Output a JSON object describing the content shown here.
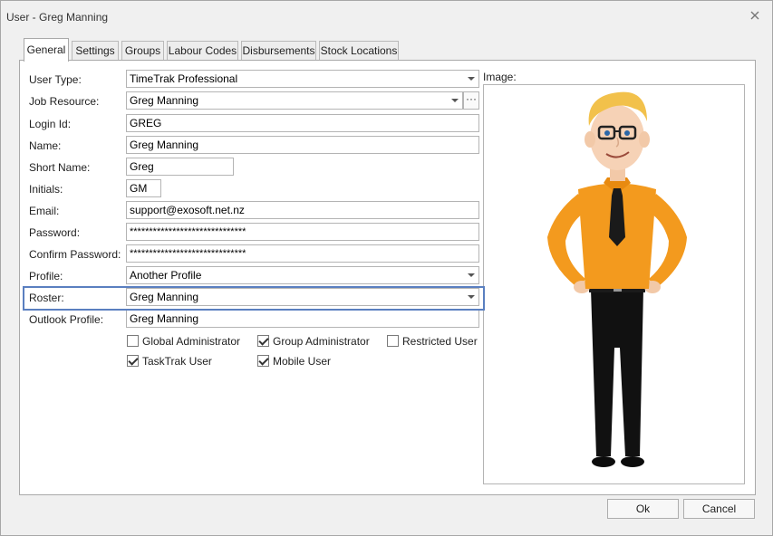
{
  "window": {
    "title": "User - Greg Manning"
  },
  "tabs": [
    {
      "label": "General"
    },
    {
      "label": "Settings"
    },
    {
      "label": "Groups"
    },
    {
      "label": "Labour Codes"
    },
    {
      "label": "Disbursements"
    },
    {
      "label": "Stock Locations"
    }
  ],
  "form": {
    "user_type": {
      "label": "User Type:",
      "value": "TimeTrak Professional"
    },
    "job_resource": {
      "label": "Job Resource:",
      "value": "Greg Manning"
    },
    "login_id": {
      "label": "Login Id:",
      "value": "GREG"
    },
    "name": {
      "label": "Name:",
      "value": "Greg Manning"
    },
    "short_name": {
      "label": "Short Name:",
      "value": "Greg"
    },
    "initials": {
      "label": "Initials:",
      "value": "GM"
    },
    "email": {
      "label": "Email:",
      "value": "support@exosoft.net.nz"
    },
    "password": {
      "label": "Password:",
      "value": "******************************"
    },
    "confirm_password": {
      "label": "Confirm Password:",
      "value": "******************************"
    },
    "profile": {
      "label": "Profile:",
      "value": "Another Profile"
    },
    "roster": {
      "label": "Roster:",
      "value": "Greg Manning"
    },
    "outlook_profile": {
      "label": "Outlook Profile:",
      "value": "Greg Manning"
    }
  },
  "checkboxes": {
    "global_admin": {
      "label": "Global Administrator",
      "checked": false
    },
    "group_admin": {
      "label": "Group Administrator",
      "checked": true
    },
    "restricted_user": {
      "label": "Restricted User",
      "checked": false
    },
    "tasktrak_user": {
      "label": "TaskTrak User",
      "checked": true
    },
    "mobile_user": {
      "label": "Mobile User",
      "checked": true
    }
  },
  "image": {
    "label": "Image:"
  },
  "buttons": {
    "ok": "Ok",
    "cancel": "Cancel"
  },
  "colors": {
    "highlight": "#5a7fc0",
    "shirt": "#f39a1e",
    "hair": "#f2c14b"
  }
}
